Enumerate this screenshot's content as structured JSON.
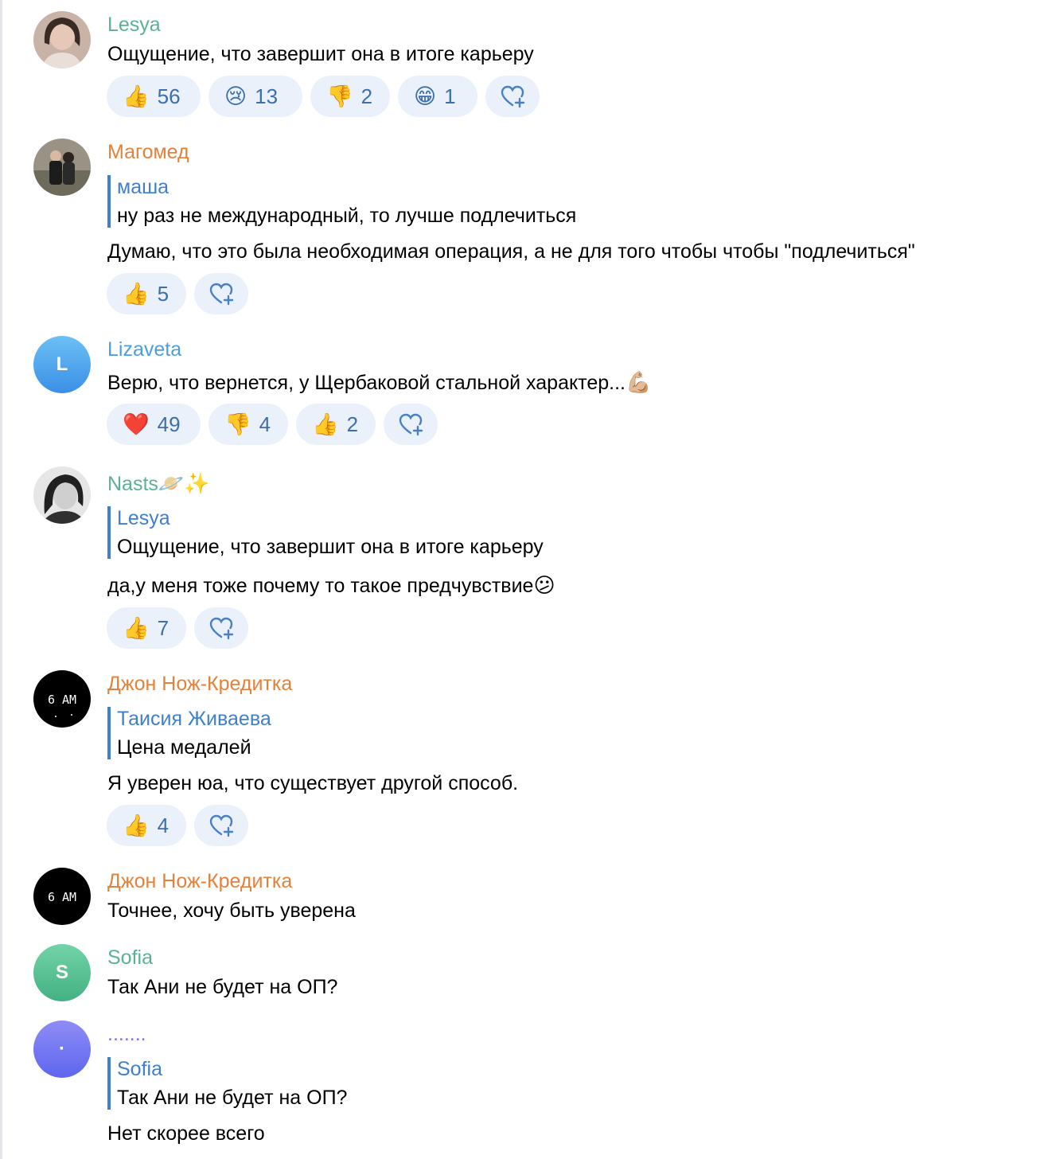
{
  "colors": {
    "quote_bar": "#3f7fcd",
    "reaction_bg": "#eaf1fb",
    "reaction_text": "#3d6fad",
    "author_green": "#5ab290",
    "author_orange": "#e4813b",
    "author_blue": "#4c9fdc",
    "author_purple": "#8e6ce0"
  },
  "comments": [
    {
      "author": "Lesya",
      "avatar": "photo-avatar-woman",
      "text": "Ощущение, что завершит она в итоге карьеру",
      "reactions": [
        {
          "emoji": "👍",
          "count": "56"
        },
        {
          "emoji": "😢",
          "count": "13"
        },
        {
          "emoji": "👎",
          "count": "2"
        },
        {
          "emoji": "😁",
          "count": "1"
        }
      ]
    },
    {
      "author": "Магомед",
      "avatar": "photo-avatar-couple",
      "quote_author": "маша",
      "quote_text": "ну раз не международный, то лучше подлечиться",
      "text": "Думаю, что это была необходимая операция, а не для того чтобы чтобы \"подлечиться\"",
      "reactions": [
        {
          "emoji": "👍",
          "count": "5"
        }
      ]
    },
    {
      "author": "Lizaveta",
      "avatar_letter": "L",
      "text": "Верю, что вернется, у Щербаковой стальной характер...",
      "text_emoji": "💪🏼",
      "reactions": [
        {
          "emoji": "❤️",
          "count": "49"
        },
        {
          "emoji": "👎",
          "count": "4"
        },
        {
          "emoji": "👍",
          "count": "2"
        }
      ]
    },
    {
      "author": "Nasts",
      "author_emoji": "🪐✨",
      "avatar": "photo-avatar-girl-bw",
      "quote_author": "Lesya",
      "quote_text": "Ощущение, что завершит она в итоге карьеру",
      "text": "да,у меня тоже почему то такое предчувствие",
      "text_emoji": "😕",
      "reactions": [
        {
          "emoji": "👍",
          "count": "7"
        }
      ]
    },
    {
      "author": "Джон Нож-Кредитка",
      "avatar_label": "6 AM",
      "quote_author": "Таисия Живаева",
      "quote_text": "Цена медалей",
      "text": "Я уверен юа, что существует другой способ.",
      "reactions": [
        {
          "emoji": "👍",
          "count": "4"
        }
      ]
    },
    {
      "author": "Джон Нож-Кредитка",
      "avatar_label": "6 AM",
      "text": "Точнее, хочу быть уверена"
    },
    {
      "author": "Sofia",
      "avatar_letter": "S",
      "text": "Так Ани не будет на ОП?"
    },
    {
      "author": ".......",
      "avatar_letter": "·",
      "quote_author": "Sofia",
      "quote_text": "Так Ани не будет на ОП?",
      "text": "Нет скорее всего"
    }
  ],
  "add_reaction_icon": "heart-plus-icon"
}
